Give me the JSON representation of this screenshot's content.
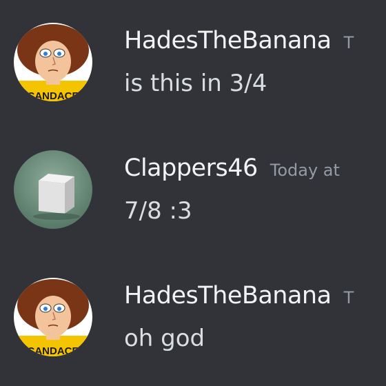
{
  "messages": [
    {
      "username": "HadesTheBanana",
      "timestamp": "T",
      "text": "is this in 3/4",
      "avatar": "cartoon-girl-avatar",
      "avatar_caption": "CANDACE"
    },
    {
      "username": "Clappers46",
      "timestamp": "Today at",
      "text": "7/8 :3",
      "avatar": "white-cube-avatar"
    },
    {
      "username": "HadesTheBanana",
      "timestamp": "T",
      "text": "oh god",
      "avatar": "cartoon-girl-avatar",
      "avatar_caption": "CANDACE"
    }
  ],
  "colors": {
    "background": "#313338",
    "username": "#f2f3f5",
    "message_text": "#dbdee1",
    "timestamp": "#949ba4"
  }
}
